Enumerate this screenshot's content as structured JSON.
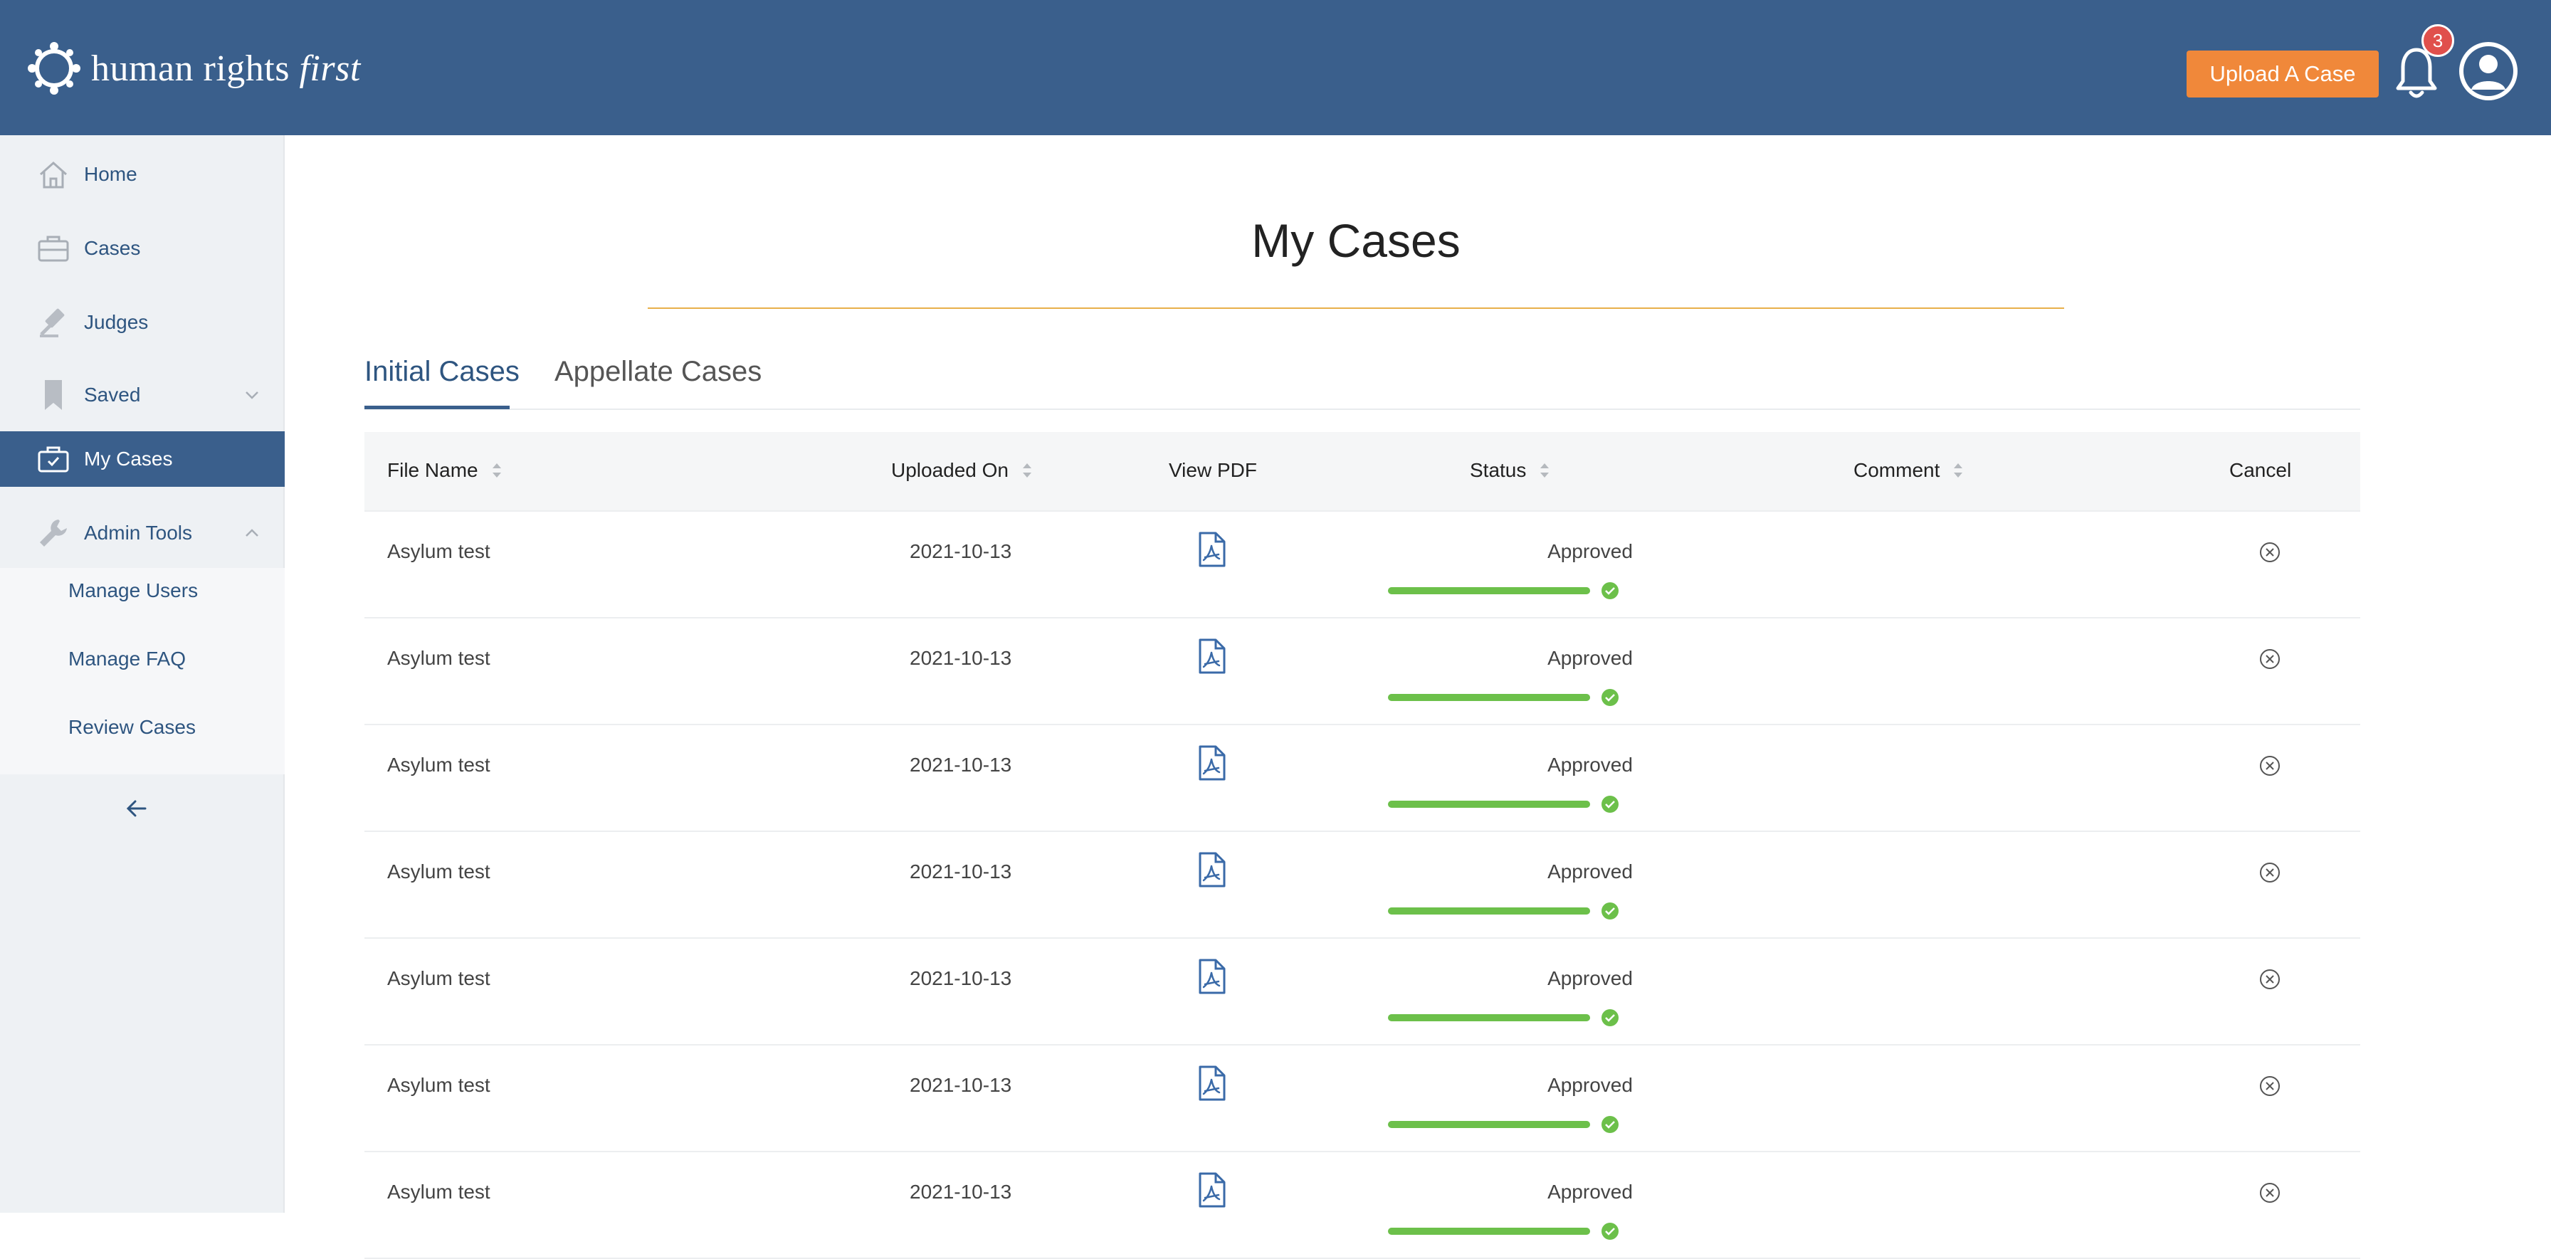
{
  "header": {
    "logo_text": "human rights",
    "logo_text_italic": "first",
    "upload_label": "Upload A Case",
    "notification_count": "3",
    "icons": [
      "logo-mark-icon",
      "bell-icon",
      "user-avatar-icon"
    ]
  },
  "sidebar": {
    "items": [
      {
        "label": "Home",
        "icon": "home-icon"
      },
      {
        "label": "Cases",
        "icon": "briefcase-icon"
      },
      {
        "label": "Judges",
        "icon": "gavel-icon"
      },
      {
        "label": "Saved",
        "icon": "bookmark-icon"
      },
      {
        "label": "My Cases",
        "icon": "briefcase-check-icon"
      },
      {
        "label": "Admin Tools",
        "icon": "wrench-icon"
      }
    ],
    "admin_sub_items": [
      "Manage Users",
      "Manage FAQ",
      "Review Cases"
    ],
    "collapse_icon": "arrow-left-icon"
  },
  "main": {
    "title": "My Cases",
    "tabs": [
      "Initial Cases",
      "Appellate Cases"
    ],
    "active_tab": "Initial Cases"
  },
  "table": {
    "columns": [
      "File Name",
      "Uploaded On",
      "View PDF",
      "Status",
      "Comment",
      "Cancel"
    ],
    "rows": [
      {
        "file_name": "Asylum test",
        "uploaded_on": "2021-10-13",
        "status": "Approved",
        "progress": 1.0,
        "comment": ""
      },
      {
        "file_name": "Asylum test",
        "uploaded_on": "2021-10-13",
        "status": "Approved",
        "progress": 1.0,
        "comment": ""
      },
      {
        "file_name": "Asylum test",
        "uploaded_on": "2021-10-13",
        "status": "Approved",
        "progress": 1.0,
        "comment": ""
      },
      {
        "file_name": "Asylum test",
        "uploaded_on": "2021-10-13",
        "status": "Approved",
        "progress": 1.0,
        "comment": ""
      },
      {
        "file_name": "Asylum test",
        "uploaded_on": "2021-10-13",
        "status": "Approved",
        "progress": 1.0,
        "comment": ""
      },
      {
        "file_name": "Asylum test",
        "uploaded_on": "2021-10-13",
        "status": "Approved",
        "progress": 1.0,
        "comment": ""
      },
      {
        "file_name": "Asylum test",
        "uploaded_on": "2021-10-13",
        "status": "Approved",
        "progress": 1.0,
        "comment": ""
      }
    ]
  },
  "colors": {
    "header_bg": "#3a5f8c",
    "accent_orange": "#f0883a",
    "badge_red": "#e0504c",
    "progress_green": "#6cc04a",
    "title_rule": "#e8b04a",
    "link_blue": "#2e5580"
  }
}
